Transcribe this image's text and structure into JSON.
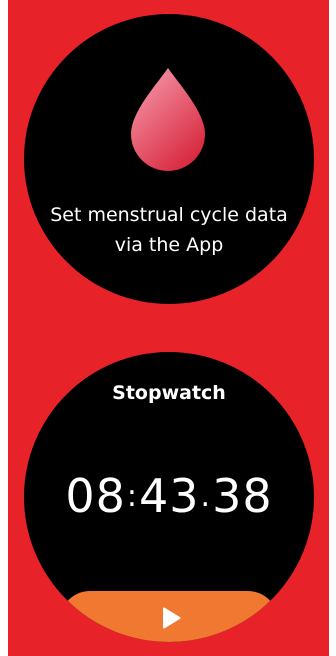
{
  "cycle_card": {
    "icon": "drop-icon",
    "line1": "Set menstrual cycle data",
    "line2": "via the App"
  },
  "stopwatch_card": {
    "title": "Stopwatch",
    "minutes": "08",
    "seconds": "43",
    "hundredths": "38",
    "separator_1": ":",
    "separator_2": ".",
    "play_icon": "play-icon"
  },
  "colors": {
    "background": "#E82229",
    "watch_face": "#000000",
    "drop_gradient_top": "#F38BA0",
    "drop_gradient_bottom": "#D8283E",
    "play_button": "#F07830",
    "text": "#FFFFFF"
  }
}
